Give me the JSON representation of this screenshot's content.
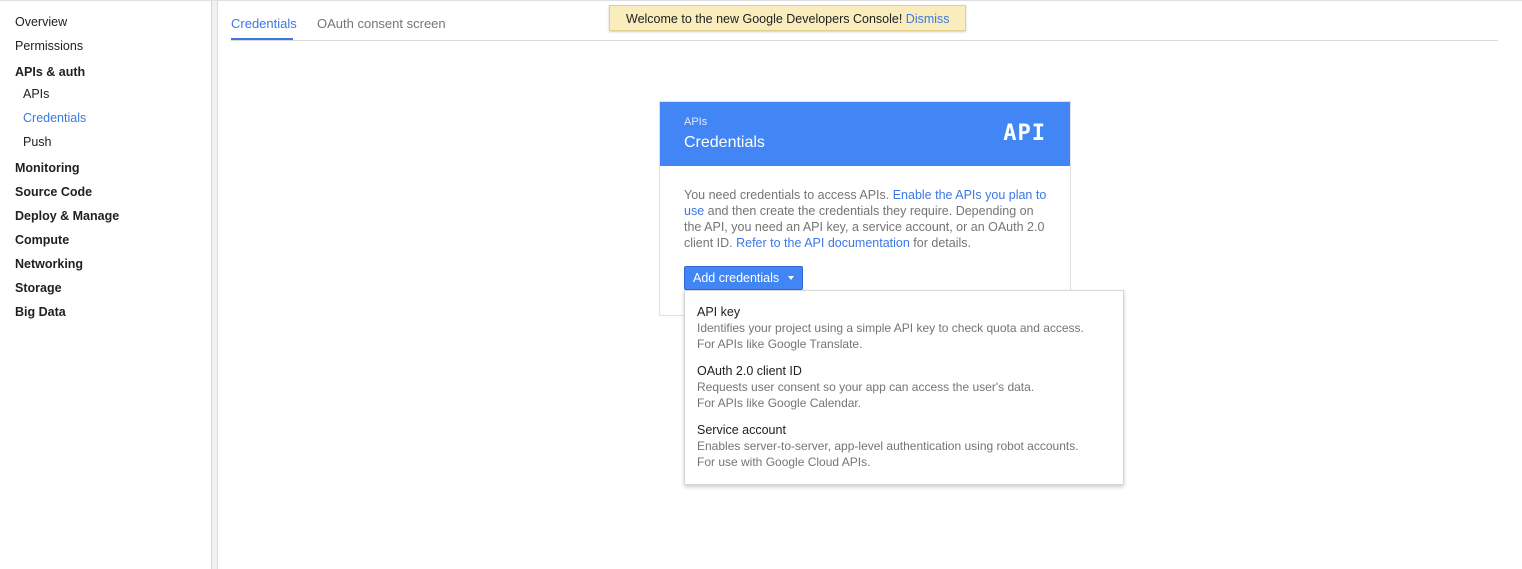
{
  "sidebar": {
    "items": [
      {
        "label": "Overview"
      },
      {
        "label": "Permissions"
      },
      {
        "label": "APIs & auth"
      },
      {
        "label": "APIs"
      },
      {
        "label": "Credentials"
      },
      {
        "label": "Push"
      },
      {
        "label": "Monitoring"
      },
      {
        "label": "Source Code"
      },
      {
        "label": "Deploy & Manage"
      },
      {
        "label": "Compute"
      },
      {
        "label": "Networking"
      },
      {
        "label": "Storage"
      },
      {
        "label": "Big Data"
      }
    ]
  },
  "tabs": [
    {
      "label": "Credentials",
      "active": true
    },
    {
      "label": "OAuth consent screen",
      "active": false
    }
  ],
  "banner": {
    "text": "Welcome to the new Google Developers Console!",
    "dismiss_label": "Dismiss"
  },
  "card": {
    "kicker": "APIs",
    "title": "Credentials",
    "logo_text": "API",
    "body": {
      "part1": "You need credentials to access APIs. ",
      "link1": "Enable the APIs you plan to use",
      "part2": " and then create the credentials they require. Depending on the API, you need an API key, a service account, or an OAuth 2.0 client ID. ",
      "link2": "Refer to the API documentation",
      "part3": " for details."
    },
    "add_button_label": "Add credentials"
  },
  "menu": {
    "items": [
      {
        "title": "API key",
        "desc1": "Identifies your project using a simple API key to check quota and access.",
        "desc2": "For APIs like Google Translate."
      },
      {
        "title": "OAuth 2.0 client ID",
        "desc1": "Requests user consent so your app can access the user's data.",
        "desc2": "For APIs like Google Calendar."
      },
      {
        "title": "Service account",
        "desc1": "Enables server-to-server, app-level authentication using robot accounts.",
        "desc2": "For use with Google Cloud APIs."
      }
    ]
  },
  "colors": {
    "accent": "#3b78e7",
    "card_header": "#4285f4",
    "banner_bg": "#f9edbe"
  }
}
